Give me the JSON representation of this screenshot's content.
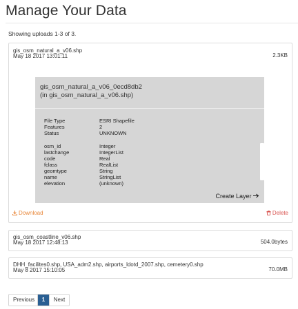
{
  "page": {
    "title": "Manage Your Data",
    "showing": "Showing uploads 1-3 of 3."
  },
  "uploads": [
    {
      "filename": "gis_osm_natural_a_v06.shp",
      "date": "May 18 2017 13:01:11",
      "size": "2.3KB"
    },
    {
      "filename": "gis_osm_coastline_v06.shp",
      "date": "May 18 2017 12:48:13",
      "size": "504.0bytes"
    },
    {
      "filename": "DHH_facilites0.shp, USA_adm2.shp, airports_ldotd_2007.shp, cemetery0.shp",
      "date": "May 8 2017 15:10:05",
      "size": "70.0MB"
    }
  ],
  "layer": {
    "name": "gis_osm_natural_a_v06_0ecd8db2",
    "source": "(in gis_osm_natural_a_v06.shp)",
    "meta": [
      {
        "key": "File Type",
        "value": "ESRI Shapefile"
      },
      {
        "key": "Features",
        "value": "2"
      },
      {
        "key": "Status",
        "value": "UNKNOWN"
      }
    ],
    "fields": [
      {
        "key": "osm_id",
        "value": "Integer"
      },
      {
        "key": "lastchange",
        "value": "IntegerList"
      },
      {
        "key": "code",
        "value": "Real"
      },
      {
        "key": "fclass",
        "value": "RealList"
      },
      {
        "key": "geomtype",
        "value": "String"
      },
      {
        "key": "name",
        "value": "StringList"
      },
      {
        "key": "elevation",
        "value": "(unknown)"
      }
    ],
    "create_label": "Create Layer",
    "create_icon": "arrow-right-icon"
  },
  "actions": {
    "download_label": "Download",
    "download_icon": "download-icon",
    "delete_label": "Delete",
    "delete_icon": "trash-icon"
  },
  "pagination": {
    "previous": "Previous",
    "current": "1",
    "next": "Next"
  },
  "colors": {
    "download": "#e8873a",
    "delete": "#d9534f",
    "active_page": "#2a5f93",
    "layer_card": "#d6d6d6"
  }
}
